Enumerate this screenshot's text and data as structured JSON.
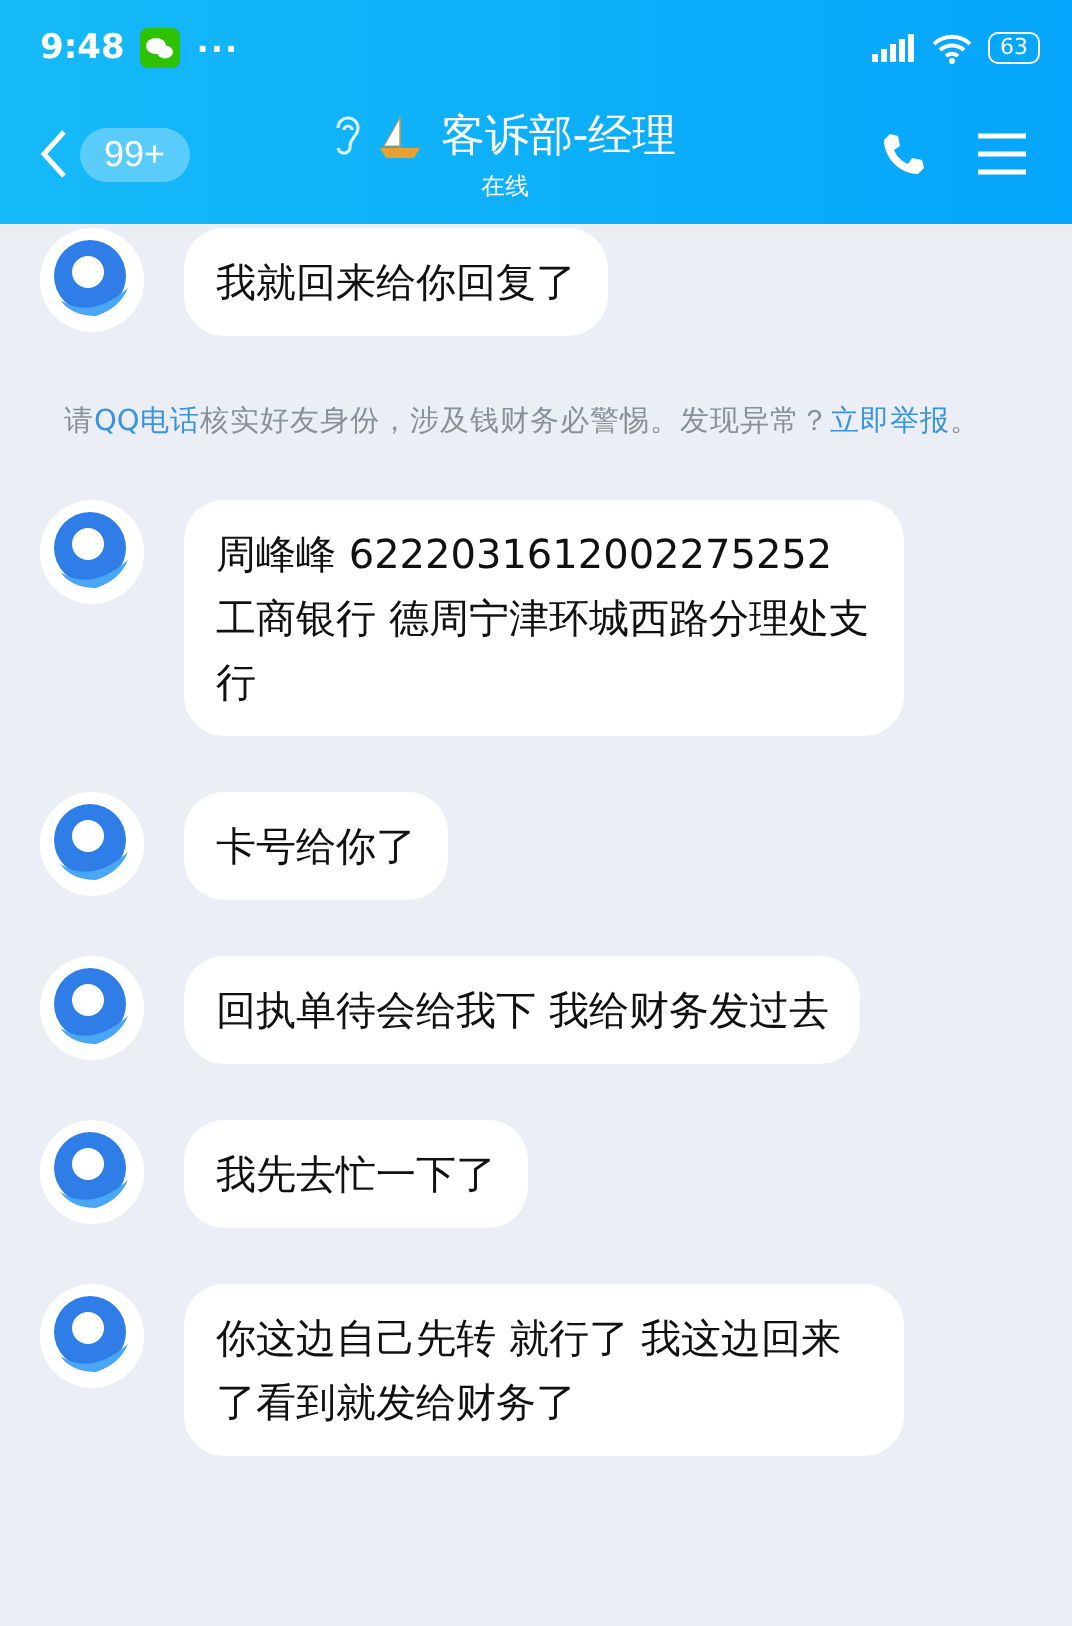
{
  "status_bar": {
    "time": "9:48",
    "more": "···",
    "battery": "63"
  },
  "header": {
    "unread": "99+",
    "title": "客诉部-经理",
    "subtitle": "在线"
  },
  "messages": [
    {
      "kind": "message",
      "text": "我就回来给你回复了"
    },
    {
      "kind": "notice",
      "text": "请**QQ电话**核实好友身份，涉及钱财务必警惕。发现异常？",
      "link": "立即举报",
      "tail": "。"
    },
    {
      "kind": "message",
      "text": "周峰峰 6222031612002275252 工商银行 德周宁津环城西路分理处支行"
    },
    {
      "kind": "message",
      "text": "卡号给你了"
    },
    {
      "kind": "message",
      "text": "回执单待会给我下 我给财务发过去"
    },
    {
      "kind": "message",
      "text": "我先去忙一下了"
    },
    {
      "kind": "message",
      "text": "你这边自己先转 就行了  我这边回来了看到就发给财务了"
    }
  ]
}
